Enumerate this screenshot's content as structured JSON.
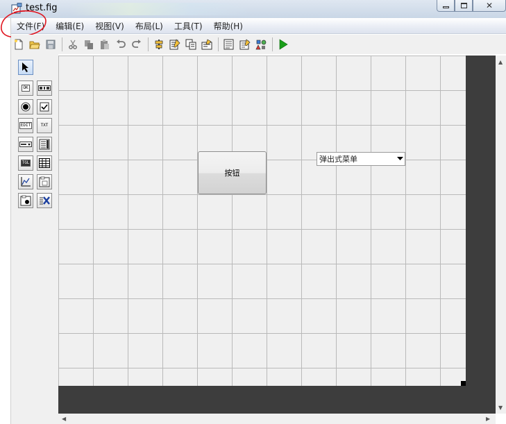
{
  "window": {
    "title": "test.fig",
    "icons": [
      "figure-icon",
      "minimize-icon",
      "maximize-icon",
      "close-icon"
    ]
  },
  "menubar": {
    "items": [
      "文件(F)",
      "编辑(E)",
      "视图(V)",
      "布局(L)",
      "工具(T)",
      "帮助(H)"
    ]
  },
  "toolbar": {
    "icons": [
      "new-icon",
      "open-icon",
      "save-icon",
      "cut-icon",
      "copy-icon",
      "paste-icon",
      "undo-icon",
      "redo-icon",
      "align-icon",
      "menu-editor-icon",
      "tab-order-icon",
      "toolbar-editor-icon",
      "editor-icon",
      "property-inspector-icon",
      "object-browser-icon",
      "run-icon"
    ]
  },
  "palette": {
    "tags": {
      "push": "OK",
      "edit": "EDIT",
      "text": "TXT",
      "toggle": "TGL"
    }
  },
  "canvas": {
    "push_button_label": "按钮",
    "popup_menu_label": "弹出式菜单"
  },
  "colors": {
    "annotation": "#e0141e",
    "run": "#1a9e1a",
    "dark_frame": "#3d3d3d"
  }
}
